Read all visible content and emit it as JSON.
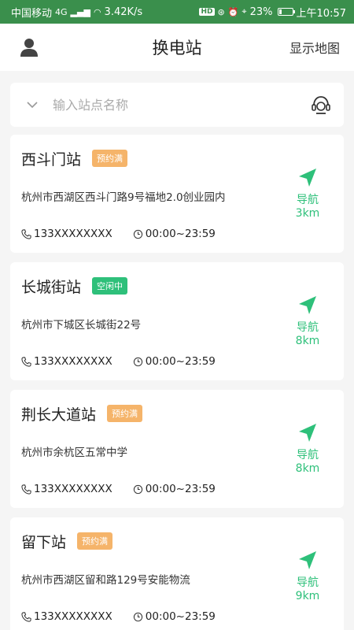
{
  "status_bar": {
    "carrier": "中国移动",
    "net_type": "4G",
    "speed": "3.42K/s",
    "battery": "23%",
    "battery_level": 0.23,
    "time": "上午10:57"
  },
  "header": {
    "title": "换电站",
    "map_link": "显示地图"
  },
  "search": {
    "placeholder": "输入站点名称"
  },
  "stations": [
    {
      "name": "西斗门站",
      "status": "预约满",
      "status_type": "full",
      "address": "杭州市西湖区西斗门路9号福地2.0创业园内",
      "phone": "133XXXXXXXX",
      "hours": "00:00~23:59",
      "nav_label": "导航",
      "distance": "3km"
    },
    {
      "name": "长城街站",
      "status": "空闲中",
      "status_type": "free",
      "address": "杭州市下城区长城街22号",
      "phone": "133XXXXXXXX",
      "hours": "00:00~23:59",
      "nav_label": "导航",
      "distance": "8km"
    },
    {
      "name": "荆长大道站",
      "status": "预约满",
      "status_type": "full",
      "address": "杭州市余杭区五常中学",
      "phone": "133XXXXXXXX",
      "hours": "00:00~23:59",
      "nav_label": "导航",
      "distance": "8km"
    },
    {
      "name": "留下站",
      "status": "预约满",
      "status_type": "full",
      "address": "杭州市西湖区留和路129号安能物流",
      "phone": "133XXXXXXXX",
      "hours": "00:00~23:59",
      "nav_label": "导航",
      "distance": "9km"
    }
  ],
  "colors": {
    "status_bar_bg": "#3a8f4c",
    "accent_green": "#2ec07a",
    "tag_full": "#f5b46a",
    "tag_free": "#2ec07a"
  },
  "icons": {
    "user": "user-icon",
    "chevron": "chevron-down-icon",
    "service": "headset-icon",
    "phone": "phone-icon",
    "clock": "clock-icon",
    "navigate": "navigation-arrow-icon"
  }
}
